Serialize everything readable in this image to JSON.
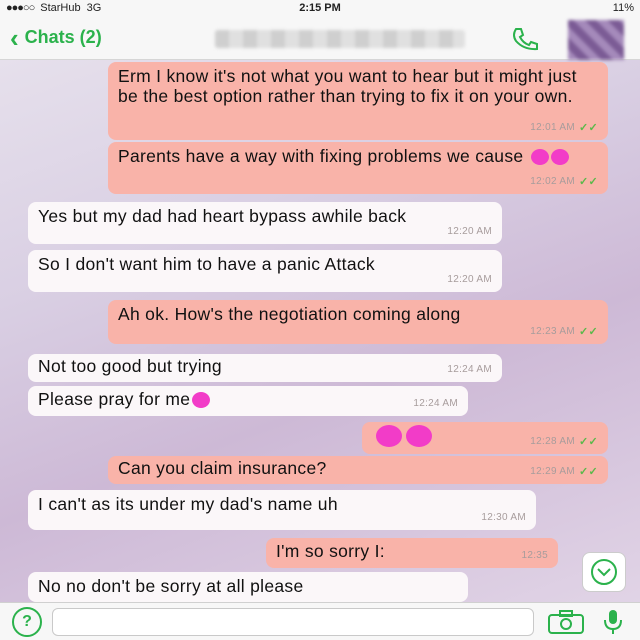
{
  "status": {
    "carrier": "StarHub",
    "network": "3G",
    "time": "2:15 PM",
    "battery": "11%"
  },
  "nav": {
    "back_label": "Chats (2)",
    "back_icon": "chevron-left-icon",
    "call_icon": "phone-icon"
  },
  "messages": [
    {
      "text": "Erm I know it's not what you want to hear but it might just be the best option rather than trying to fix it on your own.",
      "time": "12:01 AM",
      "direction": "outgoing"
    },
    {
      "text": "Parents have a way with fixing problems we cause",
      "time": "12:02 AM",
      "direction": "outgoing"
    },
    {
      "text": "Yes but my dad had heart bypass awhile back",
      "time": "12:20 AM",
      "direction": "incoming"
    },
    {
      "text": "So I don't want him to have a panic Attack",
      "time": "12:20 AM",
      "direction": "incoming"
    },
    {
      "text": "Ah ok. How's the negotiation coming along",
      "time": "12:23 AM",
      "direction": "outgoing"
    },
    {
      "text": "Not too good but trying",
      "time": "12:24 AM",
      "direction": "incoming"
    },
    {
      "text": "Please pray for me",
      "time": "12:24 AM",
      "direction": "incoming"
    },
    {
      "text": "",
      "time": "12:28 AM",
      "direction": "outgoing"
    },
    {
      "text": "Can you claim insurance?",
      "time": "12:29 AM",
      "direction": "outgoing"
    },
    {
      "text": "I can't as its under my dad's name uh",
      "time": "12:30 AM",
      "direction": "incoming"
    },
    {
      "text": "I'm so sorry I:",
      "time": "12:35",
      "direction": "outgoing"
    },
    {
      "text": "No no don't be sorry at all please",
      "time": "",
      "direction": "incoming"
    }
  ],
  "input": {
    "placeholder": ""
  },
  "colors": {
    "accent": "#2bb24c",
    "outgoing_bubble": "#f9b3a9",
    "incoming_bubble": "#fbf7f9"
  }
}
